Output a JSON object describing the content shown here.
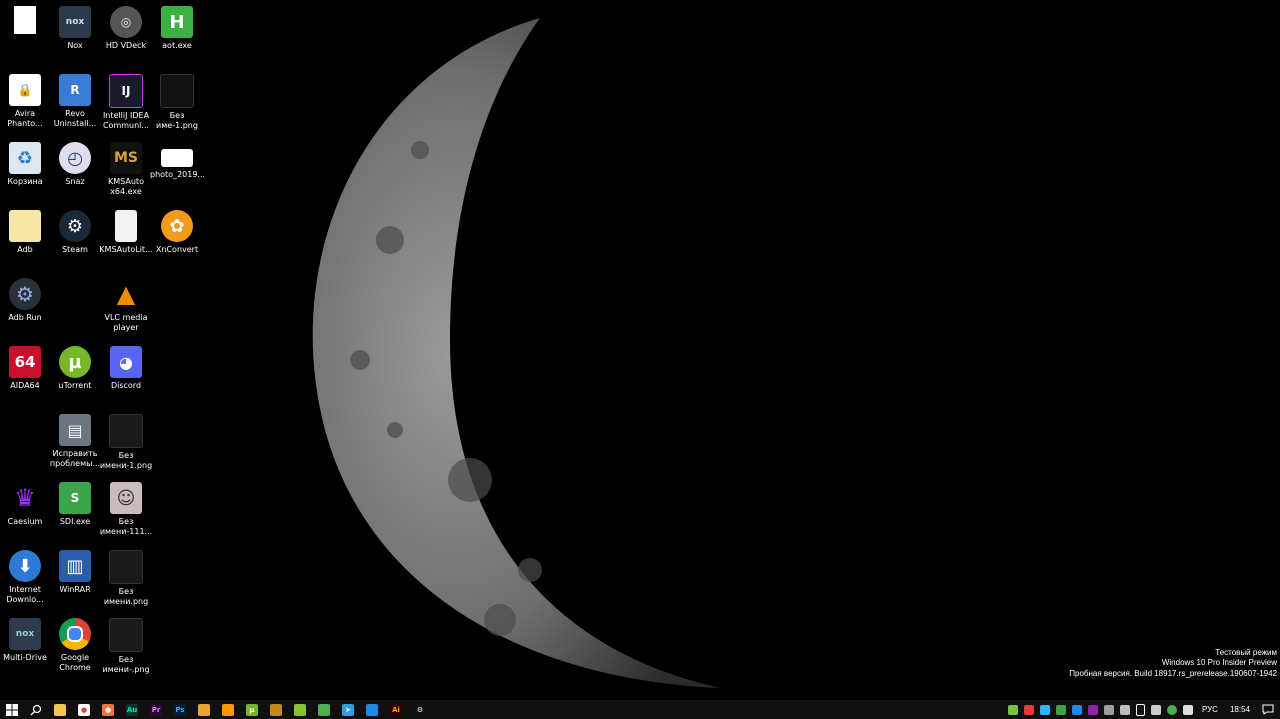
{
  "desktop": {
    "icons": [
      {
        "label": "",
        "glyph": "",
        "bg": "#ffffff",
        "fg": "#000"
      },
      {
        "label": "Nox",
        "glyph": "nox",
        "bg": "#2b3a4a",
        "fg": "#cde"
      },
      {
        "label": "HD VDeck",
        "glyph": "◎",
        "bg": "#555",
        "fg": "#eee"
      },
      {
        "label": "aot.exe",
        "glyph": "H",
        "bg": "#3cb043",
        "fg": "#fff"
      },
      {
        "label": "Avira Phanto...",
        "glyph": "🔒",
        "bg": "#ffffff",
        "fg": "#d00"
      },
      {
        "label": "Revo Uninstall...",
        "glyph": "R",
        "bg": "#3a7bd5",
        "fg": "#fff"
      },
      {
        "label": "IntelliJ IDEA Communi...",
        "glyph": "IJ",
        "bg": "#1b1b2f",
        "fg": "#fff"
      },
      {
        "label": "Без име-1.png",
        "glyph": "",
        "bg": "#111",
        "fg": "#fff"
      },
      {
        "label": "Корзина",
        "glyph": "♻",
        "bg": "#dfe7ee",
        "fg": "#2f7fd0"
      },
      {
        "label": "Snaz",
        "glyph": "◴",
        "bg": "#dde",
        "fg": "#246"
      },
      {
        "label": "KMSAuto x64.exe",
        "glyph": "MS",
        "bg": "#111",
        "fg": "#d4a536"
      },
      {
        "label": "photo_2019...",
        "glyph": "",
        "bg": "#fff",
        "fg": "#c00"
      },
      {
        "label": "Adb",
        "glyph": "",
        "bg": "#f6e7a4",
        "fg": "#555"
      },
      {
        "label": "Steam",
        "glyph": "⚙",
        "bg": "#1b2838",
        "fg": "#fff"
      },
      {
        "label": "KMSAutoLit...",
        "glyph": "",
        "bg": "#f2f2f2",
        "fg": "#555"
      },
      {
        "label": "XnConvert",
        "glyph": "✿",
        "bg": "#f29a1a",
        "fg": "#fff"
      },
      {
        "label": "Adb Run",
        "glyph": "⚙",
        "bg": "#2a2f38",
        "fg": "#9ad"
      },
      {
        "label": "VLC media player",
        "glyph": "▲",
        "bg": "transparent",
        "fg": "#f08a00"
      },
      {
        "label": "AIDA64",
        "glyph": "64",
        "bg": "#c8102e",
        "fg": "#fff"
      },
      {
        "label": "uTorrent",
        "glyph": "µ",
        "bg": "#77b82a",
        "fg": "#fff"
      },
      {
        "label": "Discord",
        "glyph": "◕",
        "bg": "#5865f2",
        "fg": "#fff"
      },
      {
        "label": "Исправить проблемы...",
        "glyph": "▤",
        "bg": "#6a7580",
        "fg": "#fff"
      },
      {
        "label": "Без имени-1.png",
        "glyph": "",
        "bg": "#1a1a1a",
        "fg": "#fff"
      },
      {
        "label": "Caesium",
        "glyph": "♛",
        "bg": "transparent",
        "fg": "#9b30ff"
      },
      {
        "label": "SDI.exe",
        "glyph": "S",
        "bg": "#3aa54a",
        "fg": "#fff"
      },
      {
        "label": "Без имени-111...",
        "glyph": "☺",
        "bg": "#cbb",
        "fg": "#333"
      },
      {
        "label": "Internet Downlo...",
        "glyph": "⬇",
        "bg": "#2d7ad6",
        "fg": "#fff"
      },
      {
        "label": "WinRAR",
        "glyph": "▥",
        "bg": "#2a5caa",
        "fg": "#fff"
      },
      {
        "label": "Без имени.png",
        "glyph": "",
        "bg": "#1a1a1a",
        "fg": "#fff"
      },
      {
        "label": "Multi-Drive",
        "glyph": "nox",
        "bg": "#2f3b4d",
        "fg": "#9cd"
      },
      {
        "label": "Google Chrome",
        "glyph": "●",
        "bg": "#ffffff",
        "fg": "#4285f4"
      },
      {
        "label": "Без имени-.png",
        "glyph": "",
        "bg": "#1a1a1a",
        "fg": "#fff"
      }
    ]
  },
  "watermark": {
    "line1": "Тестовый режим",
    "line2": "Windows 10 Pro Insider Preview",
    "line3": "Пробная версия. Build 18917.rs_prerelease.190607-1942"
  },
  "taskbar": {
    "pinned": [
      {
        "name": "file-explorer",
        "glyph": "",
        "bg": "#f2c94c",
        "fg": "#000"
      },
      {
        "name": "chrome",
        "glyph": "●",
        "bg": "#fff",
        "fg": "#db4437"
      },
      {
        "name": "firefox",
        "glyph": "●",
        "bg": "#ff7139",
        "fg": "#fff"
      },
      {
        "name": "audition",
        "glyph": "Au",
        "bg": "#00352e",
        "fg": "#00e4bb"
      },
      {
        "name": "premiere",
        "glyph": "Pr",
        "bg": "#2a0634",
        "fg": "#e77dff"
      },
      {
        "name": "photoshop",
        "glyph": "Ps",
        "bg": "#001d34",
        "fg": "#31a8ff"
      },
      {
        "name": "app-colorful",
        "glyph": "",
        "bg": "#e9a52e",
        "fg": "#fff"
      },
      {
        "name": "sublime",
        "glyph": "",
        "bg": "#ff9800",
        "fg": "#fff"
      },
      {
        "name": "utorrent",
        "glyph": "µ",
        "bg": "#77b82a",
        "fg": "#fff"
      },
      {
        "name": "app-pumpkin",
        "glyph": "",
        "bg": "#c28a1a",
        "fg": "#fff"
      },
      {
        "name": "app-green",
        "glyph": "",
        "bg": "#86c232",
        "fg": "#fff"
      },
      {
        "name": "app-cloud",
        "glyph": "",
        "bg": "#4caf50",
        "fg": "#fff"
      },
      {
        "name": "telegram",
        "glyph": "➤",
        "bg": "#2aa3e0",
        "fg": "#fff"
      },
      {
        "name": "app-blue",
        "glyph": "",
        "bg": "#1e88e5",
        "fg": "#fff"
      },
      {
        "name": "illustrator",
        "glyph": "Ai",
        "bg": "#330000",
        "fg": "#ff9a00"
      },
      {
        "name": "settings",
        "glyph": "⚙",
        "bg": "transparent",
        "fg": "#fff"
      }
    ],
    "tray": {
      "language": "РУС",
      "time": "18:54"
    }
  }
}
